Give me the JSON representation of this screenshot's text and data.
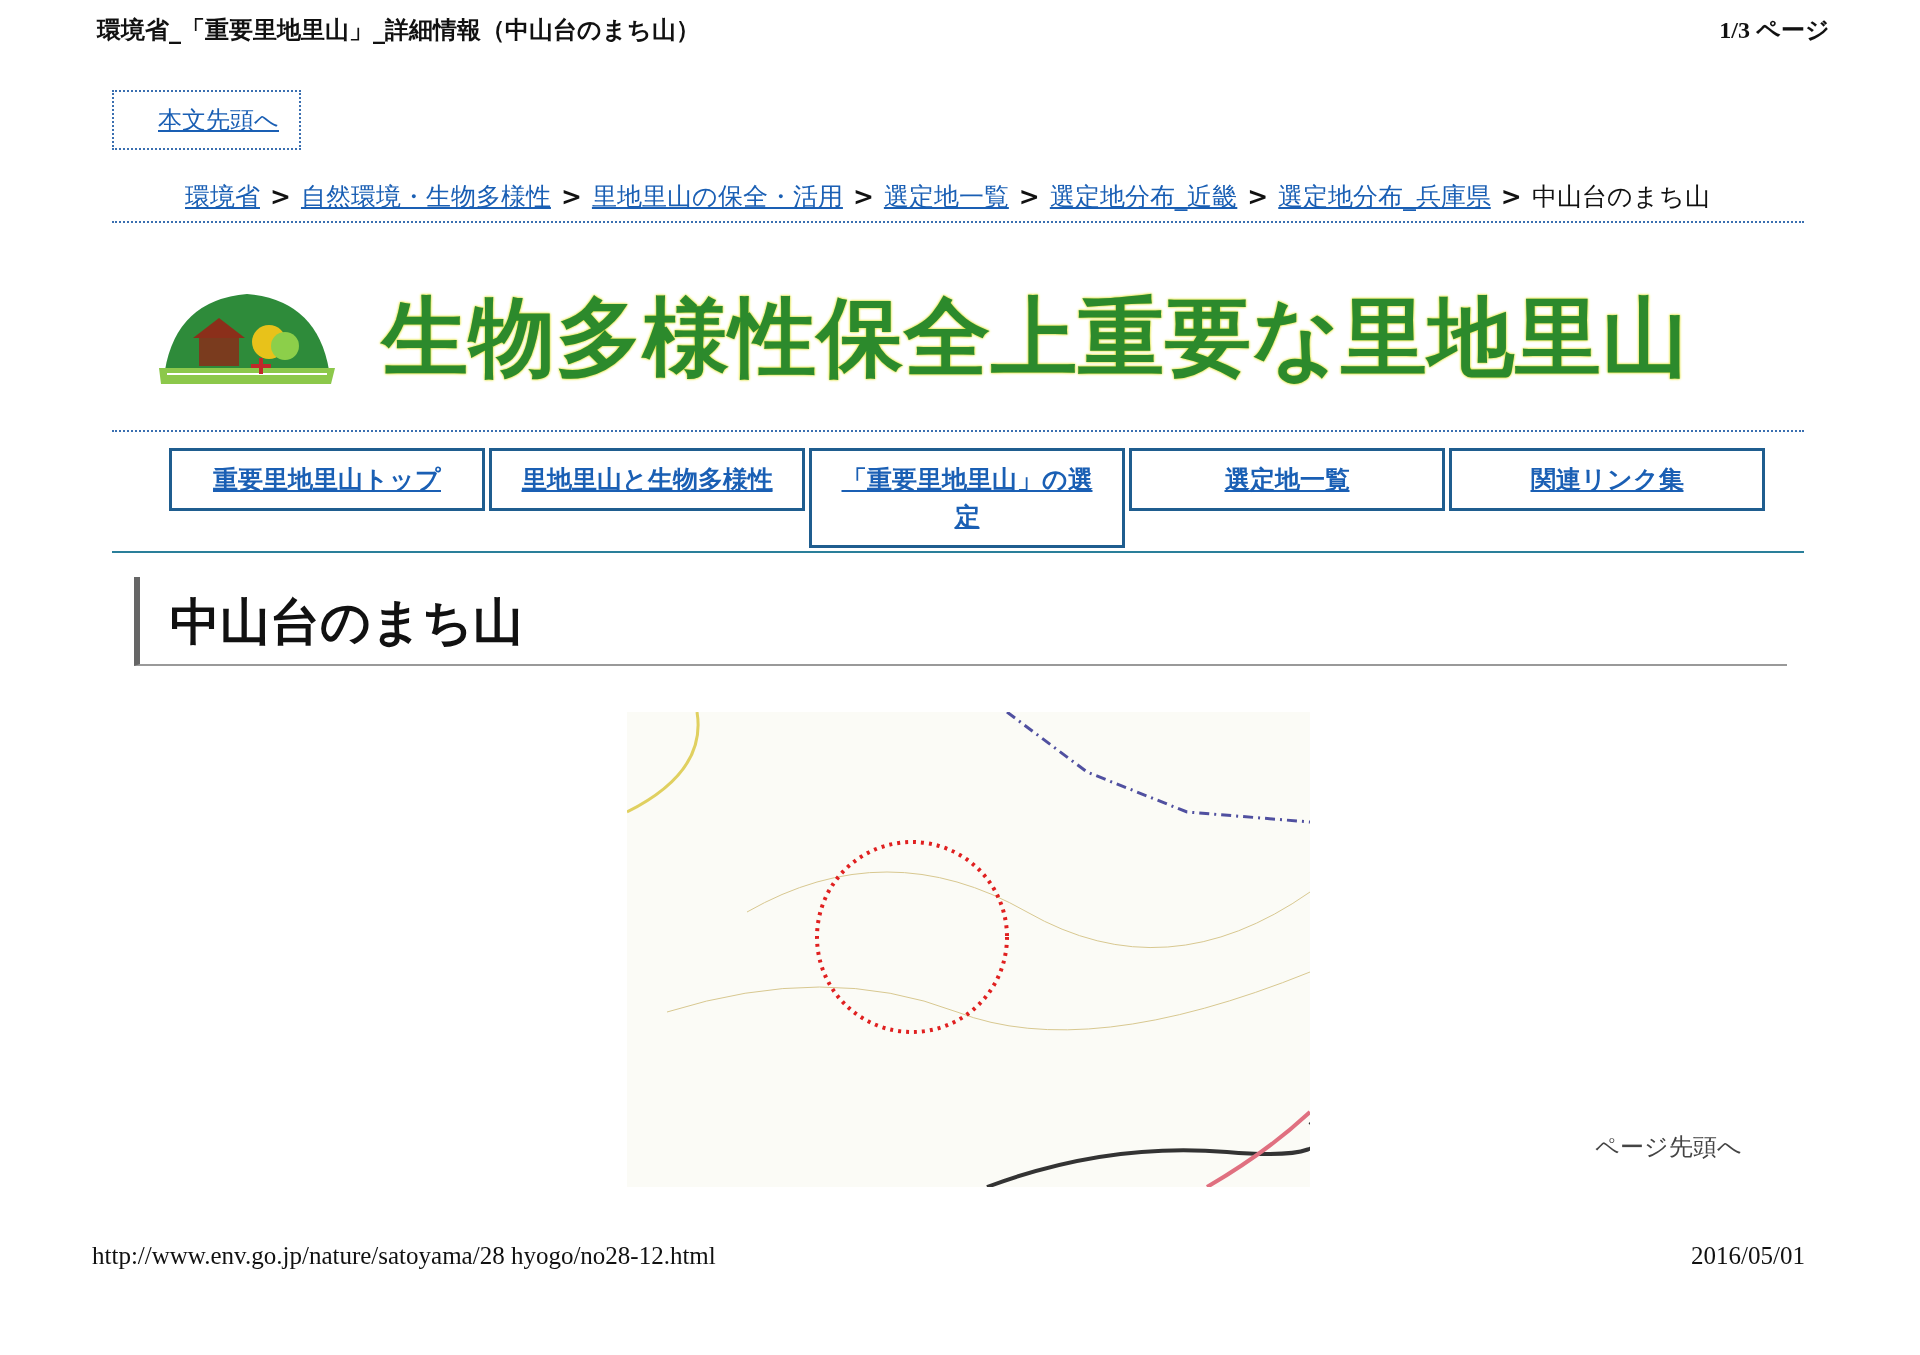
{
  "print_header": {
    "title": "環境省_「重要里地里山」_詳細情報（中山台のまち山）",
    "page_count": "1/3 ページ"
  },
  "skip_link": "本文先頭へ",
  "breadcrumb": [
    {
      "kind": "link",
      "text": "環境省"
    },
    {
      "kind": "separator",
      "text": ">"
    },
    {
      "kind": "link",
      "text": "自然環境・生物多様性"
    },
    {
      "kind": "separator",
      "text": ">"
    },
    {
      "kind": "link",
      "text": "里地里山の保全・活用"
    },
    {
      "kind": "separator",
      "text": ">"
    },
    {
      "kind": "link",
      "text": "選定地一覧"
    },
    {
      "kind": "separator",
      "text": ">"
    },
    {
      "kind": "link",
      "text": "選定地分布_近畿"
    },
    {
      "kind": "separator",
      "text": ">"
    },
    {
      "kind": "link",
      "text": "選定地分布_兵庫県"
    },
    {
      "kind": "separator",
      "text": ">"
    },
    {
      "kind": "current",
      "text": "中山台のまち山"
    }
  ],
  "banner": {
    "title": "生物多様性保全上重要な里地里山"
  },
  "nav": [
    {
      "label": "重要里地里山トップ"
    },
    {
      "label": "里地里山と生物多様性"
    },
    {
      "label": "「重要里地里山」の選定"
    },
    {
      "label": "選定地一覧"
    },
    {
      "label": "関連リンク集"
    }
  ],
  "heading": "中山台のまち山",
  "back_to_top": "ページ先頭へ",
  "print_footer": {
    "url": "http://www.env.go.jp/nature/satoyama/28 hyogo/no28-12.html",
    "date": "2016/05/01"
  }
}
